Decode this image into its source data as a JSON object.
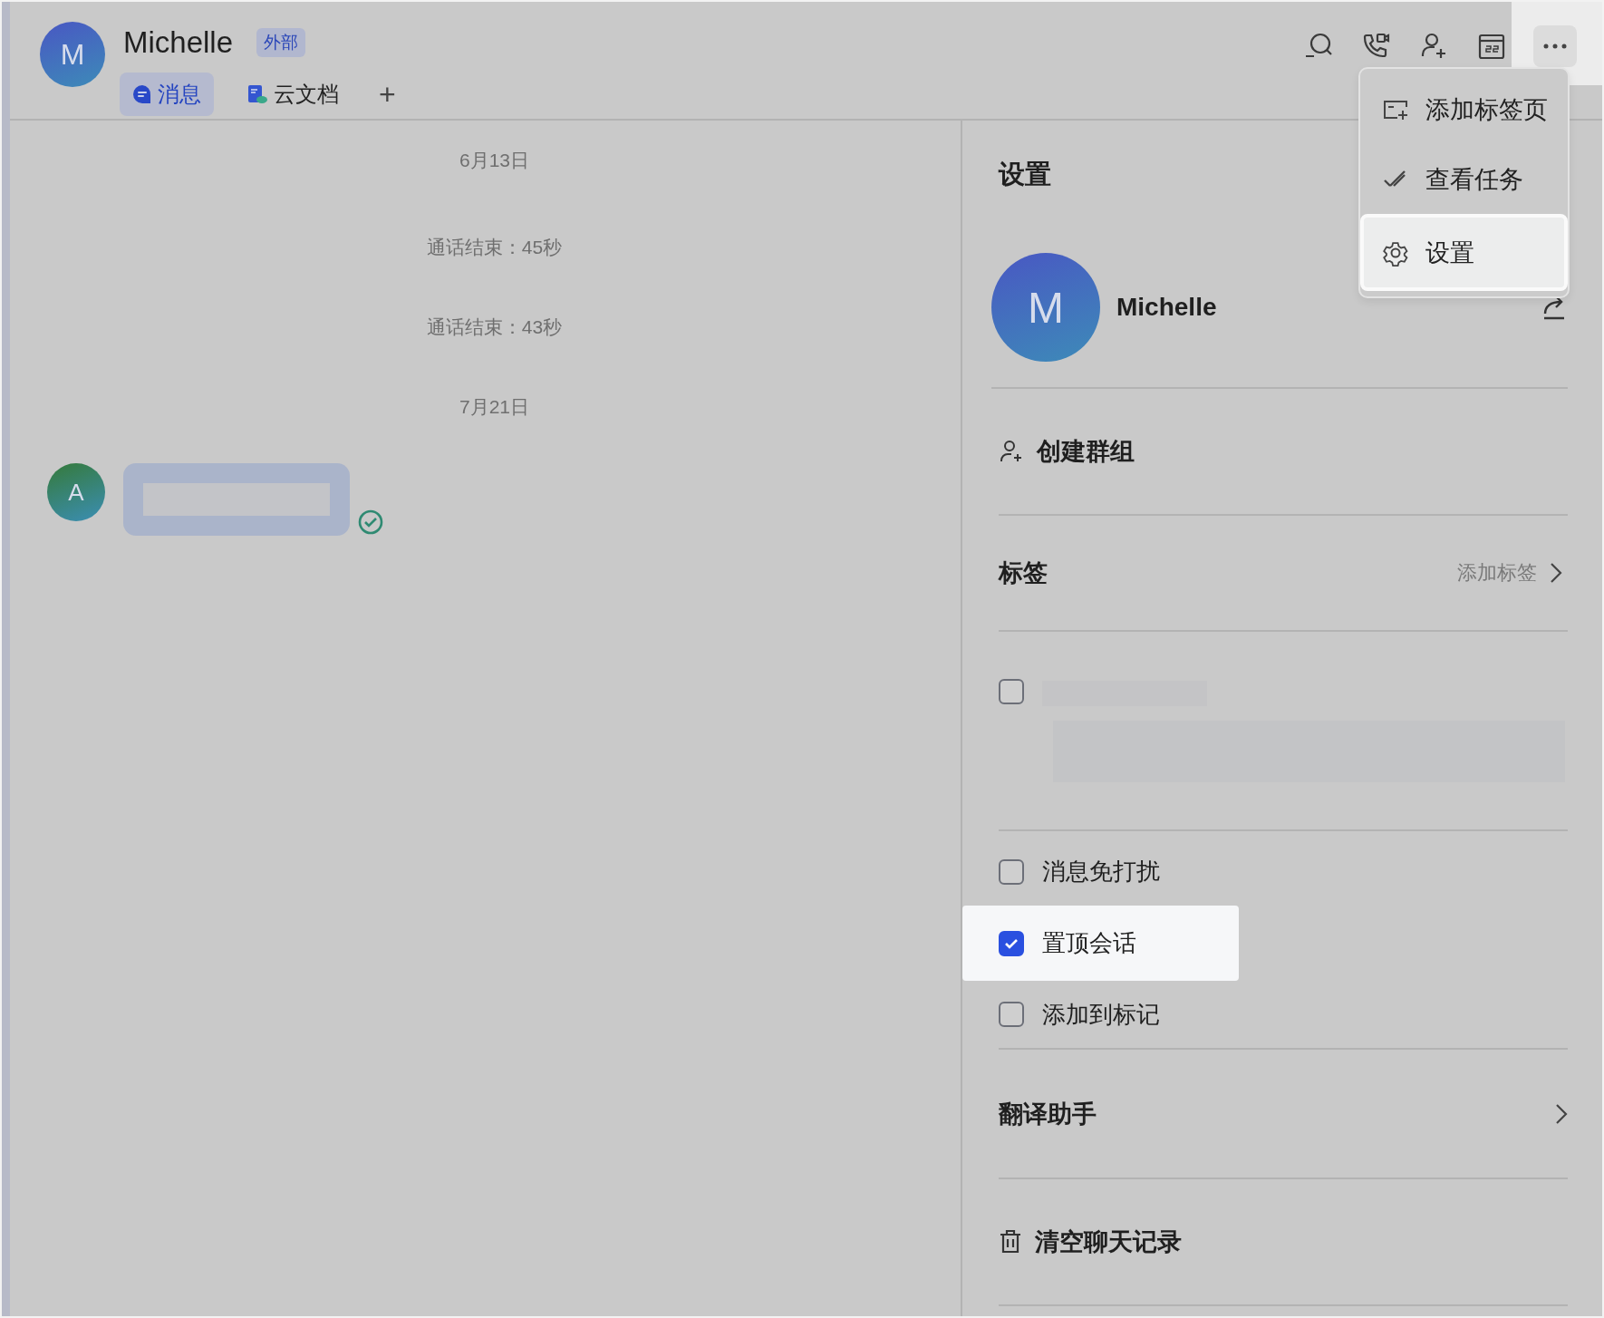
{
  "header": {
    "avatar_initial": "M",
    "name": "Michelle",
    "badge": "外部",
    "tabs": [
      {
        "label": "消息",
        "selected": true
      },
      {
        "label": "云文档",
        "selected": false
      }
    ],
    "add_tab": "+"
  },
  "menu": {
    "items": [
      {
        "label": "添加标签页",
        "selected": false
      },
      {
        "label": "查看任务",
        "selected": false
      },
      {
        "label": "设置",
        "selected": true
      }
    ]
  },
  "chat": {
    "items": [
      {
        "kind": "date",
        "text": "6月13日"
      },
      {
        "kind": "system",
        "text": "通话结束：45秒"
      },
      {
        "kind": "system",
        "text": "通话结束：43秒"
      },
      {
        "kind": "date",
        "text": "7月21日"
      },
      {
        "kind": "message",
        "avatar_initial": "A"
      }
    ]
  },
  "settings": {
    "title": "设置",
    "profile": {
      "initial": "M",
      "name": "Michelle"
    },
    "sections": [
      [
        {
          "kind": "create_group",
          "label": "创建群组"
        }
      ],
      [
        {
          "kind": "link",
          "label": "标签",
          "value": "添加标签"
        }
      ],
      [
        {
          "kind": "redacted",
          "checked": false
        }
      ],
      [
        {
          "kind": "checkbox",
          "label": "消息免打扰",
          "checked": false,
          "highlighted": false
        },
        {
          "kind": "checkbox",
          "label": "置顶会话",
          "checked": true,
          "highlighted": true
        },
        {
          "kind": "checkbox",
          "label": "添加到标记",
          "checked": false,
          "highlighted": false
        }
      ],
      [
        {
          "kind": "nav",
          "label": "翻译助手"
        }
      ],
      [
        {
          "kind": "clear_history",
          "label": "清空聊天记录"
        }
      ]
    ]
  }
}
